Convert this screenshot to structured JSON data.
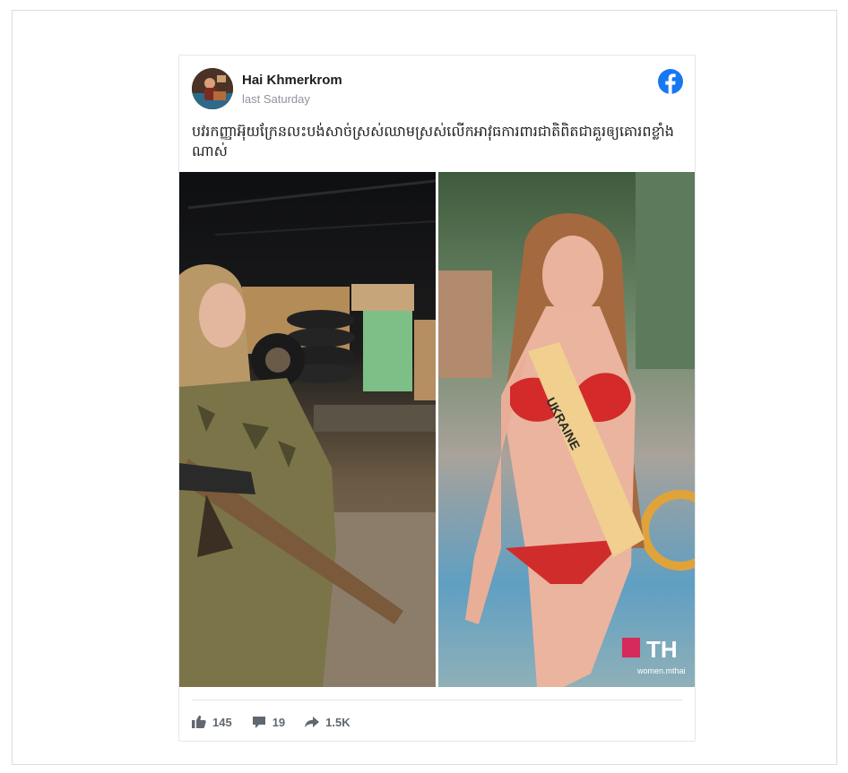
{
  "post": {
    "author": "Hai Khmerkrom",
    "time": "last Saturday",
    "platform_icon": "facebook-icon",
    "text": "បវរកញ្ញាអ៊ុយក្រែនលះបង់សាច់ស្រស់ឈាមស្រស់លើកអាវុធការពារជាតិពិតជាគួរឲ្យគោរពខ្លាំងណាស់"
  },
  "images": [
    {
      "name": "soldier-photo",
      "description_icon": "photo-icon"
    },
    {
      "name": "pageant-photo",
      "sash_text": "UKRAINE",
      "watermark": "TH",
      "watermark_sub": "women.mthai"
    }
  ],
  "stats": {
    "likes": "145",
    "comments": "19",
    "shares": "1.5K",
    "like_icon": "thumbs-up-icon",
    "comment_icon": "comment-icon",
    "share_icon": "share-arrow-icon"
  },
  "colors": {
    "facebook_blue": "#1877f2",
    "text_primary": "#1c1e21",
    "text_secondary": "#90949c",
    "stat_gray": "#606770"
  }
}
